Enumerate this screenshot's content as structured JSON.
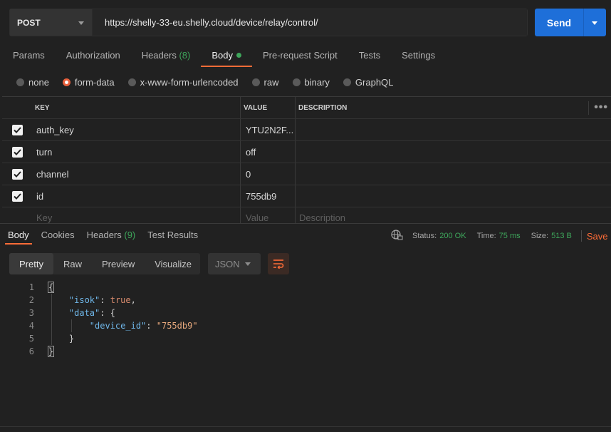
{
  "request": {
    "method": "POST",
    "url": "https://shelly-33-eu.shelly.cloud/device/relay/control/",
    "send_label": "Send"
  },
  "req_tabs": [
    {
      "label": "Params"
    },
    {
      "label": "Authorization"
    },
    {
      "label": "Headers",
      "count": "(8)"
    },
    {
      "label": "Body"
    },
    {
      "label": "Pre-request Script"
    },
    {
      "label": "Tests"
    },
    {
      "label": "Settings"
    }
  ],
  "body_types": [
    {
      "label": "none",
      "selected": false
    },
    {
      "label": "form-data",
      "selected": true
    },
    {
      "label": "x-www-form-urlencoded",
      "selected": false
    },
    {
      "label": "raw",
      "selected": false
    },
    {
      "label": "binary",
      "selected": false
    },
    {
      "label": "GraphQL",
      "selected": false
    }
  ],
  "params_table": {
    "headers": {
      "key": "KEY",
      "value": "VALUE",
      "description": "DESCRIPTION"
    },
    "rows": [
      {
        "key": "auth_key",
        "value": "YTU2N2F...",
        "checked": true
      },
      {
        "key": "turn",
        "value": "off",
        "checked": true
      },
      {
        "key": "channel",
        "value": "0",
        "checked": true
      },
      {
        "key": "id",
        "value": "755db9",
        "checked": true
      }
    ],
    "placeholders": {
      "key": "Key",
      "value": "Value",
      "description": "Description"
    }
  },
  "response": {
    "tabs": [
      {
        "label": "Body"
      },
      {
        "label": "Cookies"
      },
      {
        "label": "Headers",
        "count": "(9)"
      },
      {
        "label": "Test Results"
      }
    ],
    "status_label": "Status:",
    "status_value": "200 OK",
    "time_label": "Time:",
    "time_value": "75 ms",
    "size_label": "Size:",
    "size_value": "513 B",
    "save_label": "Save",
    "views": [
      "Pretty",
      "Raw",
      "Preview",
      "Visualize"
    ],
    "format": "JSON",
    "code_lines": [
      {
        "n": "1",
        "text": "{"
      },
      {
        "n": "2",
        "text": "    \"isok\": true,"
      },
      {
        "n": "3",
        "text": "    \"data\": {"
      },
      {
        "n": "4",
        "text": "        \"device_id\": \"755db9\""
      },
      {
        "n": "5",
        "text": "    }"
      },
      {
        "n": "6",
        "text": "}"
      }
    ]
  },
  "colors": {
    "accent": "#ff6c37",
    "send": "#1e6fd9",
    "success": "#3ea65b",
    "background": "#212121"
  }
}
